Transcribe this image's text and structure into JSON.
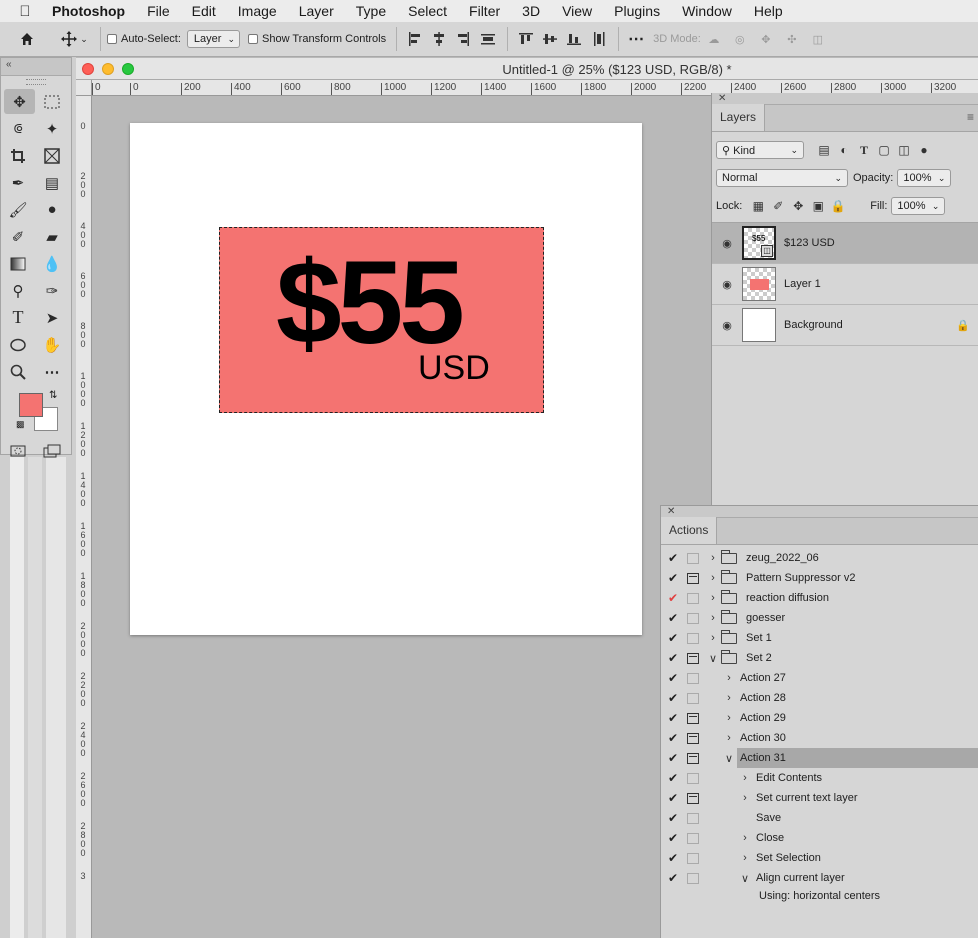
{
  "menubar": {
    "apple_icon": "apple-logo-icon",
    "app_name": "Photoshop",
    "items": [
      "File",
      "Edit",
      "Image",
      "Layer",
      "Type",
      "Select",
      "Filter",
      "3D",
      "View",
      "Plugins",
      "Window",
      "Help"
    ]
  },
  "options_bar": {
    "auto_select_label": "Auto-Select:",
    "auto_select_value": "Layer",
    "show_transform_label": "Show Transform Controls",
    "mode_3d_label": "3D Mode:"
  },
  "document": {
    "title": "Untitled-1 @ 25% ($123 USD, RGB/8) *",
    "price_text": "$55",
    "currency_text": "USD",
    "rect_color": "#f47371",
    "hruler_labels": [
      "0",
      "0",
      "200",
      "400",
      "600",
      "800",
      "1000",
      "1200",
      "1400",
      "1600",
      "1800",
      "2000",
      "2200",
      "2400",
      "2600",
      "2800",
      "3000",
      "3200"
    ],
    "vruler_labels": [
      "0",
      "2 0 0",
      "4 0 0",
      "6 0 0",
      "8 0 0",
      "1 0 0 0",
      "1 2 0 0",
      "1 4 0 0",
      "1 6 0 0",
      "1 8 0 0",
      "2 0 0 0",
      "2 2 0 0",
      "2 4 0 0",
      "2 6 0 0",
      "2 8 0 0",
      "3"
    ]
  },
  "tools": {
    "fg_color": "#f47371",
    "bg_color": "#ffffff"
  },
  "layers_panel": {
    "tab": "Layers",
    "filter_value": "Kind",
    "blend_mode": "Normal",
    "opacity_label": "Opacity:",
    "opacity_value": "100%",
    "lock_label": "Lock:",
    "fill_label": "Fill:",
    "fill_value": "100%",
    "layers": [
      {
        "name": "$123 USD",
        "selected": true,
        "thumb_text": "$55"
      },
      {
        "name": "Layer 1",
        "selected": false
      },
      {
        "name": "Background",
        "selected": false,
        "locked": true
      }
    ]
  },
  "actions_panel": {
    "tab": "Actions",
    "rows": [
      {
        "name": "zeug_2022_06",
        "type": "set",
        "check": "on",
        "dialog": false,
        "disclosure": "closed",
        "indent": 0
      },
      {
        "name": "Pattern Suppressor v2",
        "type": "set",
        "check": "on",
        "dialog": true,
        "disclosure": "closed",
        "indent": 0
      },
      {
        "name": "reaction diffusion",
        "type": "set",
        "check": "red",
        "dialog": false,
        "disclosure": "closed",
        "indent": 0
      },
      {
        "name": "goesser",
        "type": "set",
        "check": "on",
        "dialog": false,
        "disclosure": "closed",
        "indent": 0
      },
      {
        "name": "Set 1",
        "type": "set",
        "check": "on",
        "dialog": false,
        "disclosure": "closed",
        "indent": 0
      },
      {
        "name": "Set 2",
        "type": "set",
        "check": "on",
        "dialog": true,
        "disclosure": "open",
        "indent": 0
      },
      {
        "name": "Action 27",
        "type": "action",
        "check": "on",
        "dialog": false,
        "disclosure": "closed",
        "indent": 1
      },
      {
        "name": "Action 28",
        "type": "action",
        "check": "on",
        "dialog": false,
        "disclosure": "closed",
        "indent": 1
      },
      {
        "name": "Action 29",
        "type": "action",
        "check": "on",
        "dialog": true,
        "disclosure": "closed",
        "indent": 1
      },
      {
        "name": "Action 30",
        "type": "action",
        "check": "on",
        "dialog": true,
        "disclosure": "closed",
        "indent": 1
      },
      {
        "name": "Action 31",
        "type": "action",
        "check": "on",
        "dialog": true,
        "disclosure": "open",
        "indent": 1,
        "selected": true
      },
      {
        "name": "Edit Contents",
        "type": "step",
        "check": "on",
        "dialog": false,
        "disclosure": "closed",
        "indent": 2
      },
      {
        "name": "Set current text layer",
        "type": "step",
        "check": "on",
        "dialog": true,
        "disclosure": "closed",
        "indent": 2
      },
      {
        "name": "Save",
        "type": "step",
        "check": "on",
        "dialog": false,
        "disclosure": "none",
        "indent": 2
      },
      {
        "name": "Close",
        "type": "step",
        "check": "on",
        "dialog": false,
        "disclosure": "closed",
        "indent": 2
      },
      {
        "name": "Set Selection",
        "type": "step",
        "check": "on",
        "dialog": false,
        "disclosure": "closed",
        "indent": 2
      },
      {
        "name": "Align current layer",
        "type": "step",
        "check": "on",
        "dialog": false,
        "disclosure": "open",
        "indent": 2
      }
    ],
    "note": "Using: horizontal centers"
  }
}
